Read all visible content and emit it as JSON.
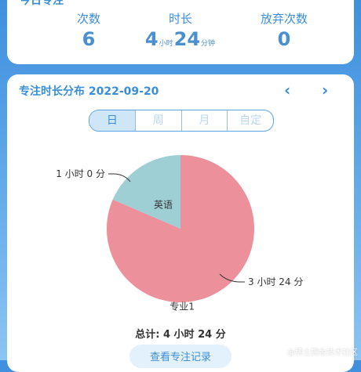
{
  "stats": {
    "title": "今日专注",
    "items": [
      {
        "label": "次数",
        "value": "6"
      },
      {
        "label": "时长",
        "hours": "4",
        "hours_unit": "小时",
        "minutes": "24",
        "minutes_unit": "分钟"
      },
      {
        "label": "放弃次数",
        "value": "0"
      }
    ]
  },
  "chart_card": {
    "title": "专注时长分布 2022-09-20",
    "prev_icon": "chevron-left-icon",
    "next_icon": "chevron-right-icon",
    "tabs": [
      {
        "label": "日",
        "active": true
      },
      {
        "label": "周",
        "active": false
      },
      {
        "label": "月",
        "active": false
      },
      {
        "label": "自定",
        "active": false
      }
    ],
    "total": "总计: 4 小时 24 分",
    "view_button": "查看专注记录"
  },
  "chart_data": {
    "type": "pie",
    "slices": [
      {
        "label": "专业1",
        "value": 264,
        "value_label": "3 小时 24 分",
        "color": "#ec909c"
      },
      {
        "label": "英语",
        "value": 60,
        "value_label": "1 小时 0 分",
        "color": "#9ecfd4"
      }
    ]
  },
  "watermark": "@稀土掘金技术社区"
}
